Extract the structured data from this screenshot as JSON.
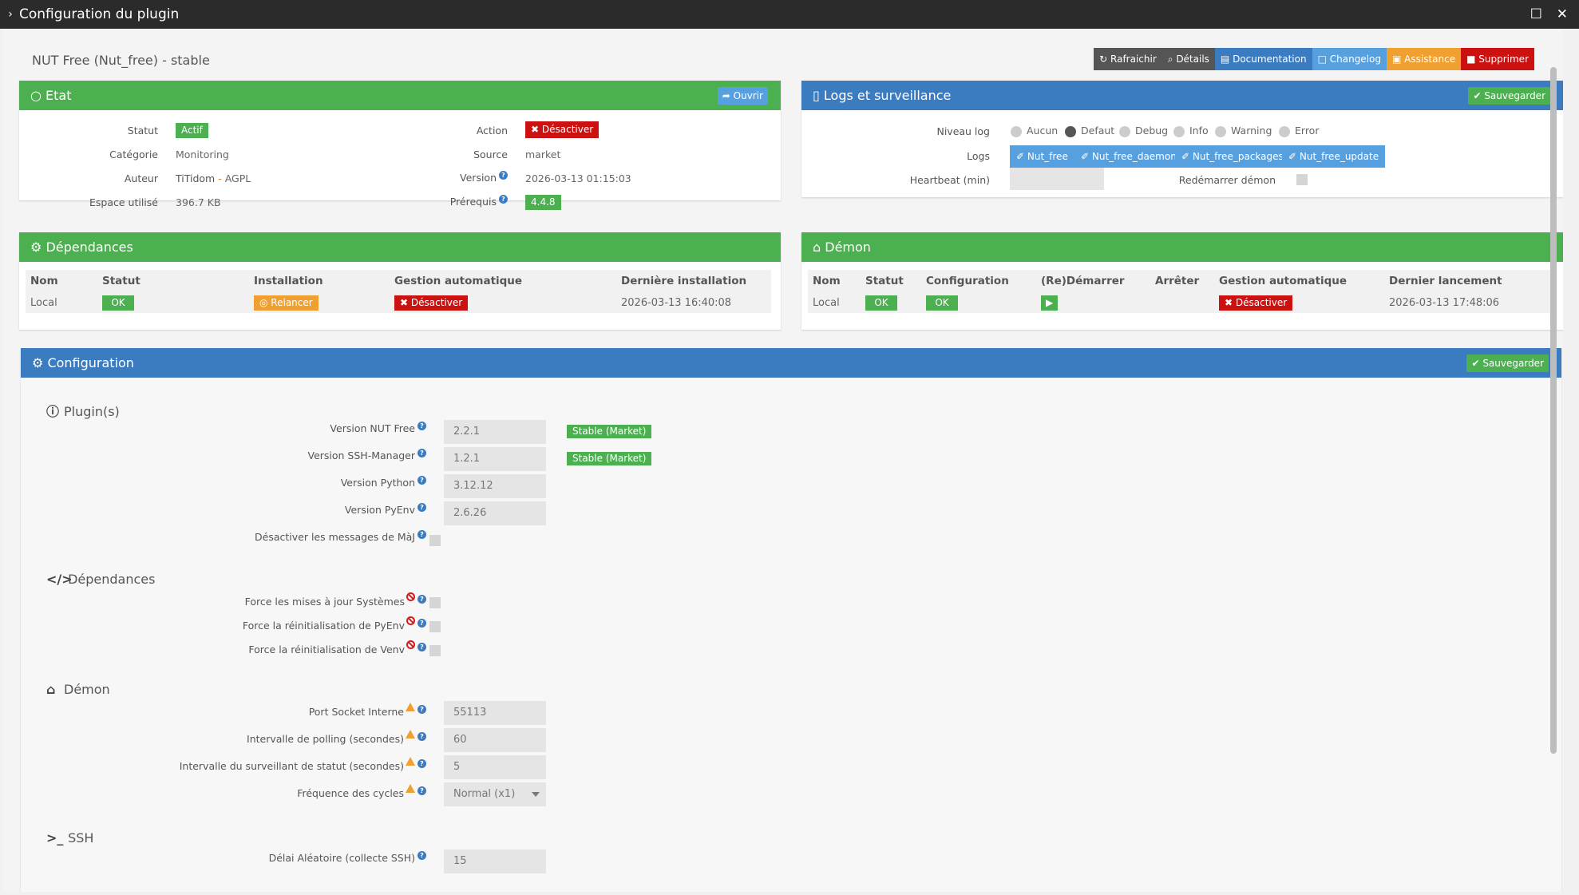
{
  "window": {
    "title": "Configuration du plugin"
  },
  "plugin": {
    "title": "NUT Free (Nut_free) - stable"
  },
  "actions": [
    {
      "label": "Rafraichir",
      "color": "#555555",
      "icon": "refresh-icon"
    },
    {
      "label": "Détails",
      "color": "#555555",
      "icon": "search-icon"
    },
    {
      "label": "Documentation",
      "color": "#3b7cc0",
      "icon": "book-icon"
    },
    {
      "label": "Changelog",
      "color": "#57a0e0",
      "icon": "file-icon"
    },
    {
      "label": "Assistance",
      "color": "#f0a030",
      "icon": "truck-icon"
    },
    {
      "label": "Supprimer",
      "color": "#cc1111",
      "icon": "trash-icon"
    }
  ],
  "etat": {
    "title": "Etat",
    "open_button": "Ouvrir",
    "statut_label": "Statut",
    "statut_value": "Actif",
    "categorie_label": "Catégorie",
    "categorie_value": "Monitoring",
    "auteur_label": "Auteur",
    "auteur_value": "TiTidom",
    "auteur_sep": " - ",
    "licence_value": "AGPL",
    "espace_label": "Espace utilisé",
    "espace_value": "396.7 KB",
    "action_label": "Action",
    "action_button": "Désactiver",
    "source_label": "Source",
    "source_value": "market",
    "version_label": "Version",
    "version_value": "2026-03-13 01:15:03",
    "prerequis_label": "Prérequis",
    "prerequis_value": "4.4.8"
  },
  "logs": {
    "title": "Logs et surveillance",
    "save_button": "Sauvegarder",
    "niveau_label": "Niveau log",
    "levels": [
      "Aucun",
      "Defaut",
      "Debug",
      "Info",
      "Warning",
      "Error"
    ],
    "selected_level": "Defaut",
    "logs_label": "Logs",
    "log_files": [
      "Nut_free",
      "Nut_free_daemon",
      "Nut_free_packages",
      "Nut_free_update"
    ],
    "heartbeat_label": "Heartbeat (min)",
    "heartbeat_value": "",
    "restart_label": "Redémarrer démon"
  },
  "dependances": {
    "title": "Dépendances",
    "headers": [
      "Nom",
      "Statut",
      "Installation",
      "Gestion automatique",
      "Dernière installation"
    ],
    "row": {
      "nom": "Local",
      "statut": "OK",
      "installation": "Relancer",
      "gestion": "Désactiver",
      "derniere": "2026-03-13 16:40:08"
    }
  },
  "demon": {
    "title": "Démon",
    "headers": [
      "Nom",
      "Statut",
      "Configuration",
      "(Re)Démarrer",
      "Arrêter",
      "Gestion automatique",
      "Dernier lancement"
    ],
    "row": {
      "nom": "Local",
      "statut": "OK",
      "configuration": "OK",
      "gestion": "Désactiver",
      "dernier": "2026-03-13 17:48:06"
    }
  },
  "configuration": {
    "title": "Configuration",
    "save_button": "Sauvegarder",
    "plugins_section": "Plugin(s)",
    "nut_version_label": "Version NUT Free",
    "nut_version_value": "2.2.1",
    "nut_stable": "Stable (Market)",
    "ssh_version_label": "Version SSH-Manager",
    "ssh_version_value": "1.2.1",
    "ssh_stable": "Stable (Market)",
    "python_label": "Version Python",
    "python_value": "3.12.12",
    "pyenv_label": "Version PyEnv",
    "pyenv_value": "2.6.26",
    "maj_label": "Désactiver les messages de MàJ",
    "dep_section": "Dépendances",
    "force_sys_label": "Force les mises à jour Systèmes",
    "force_pyenv_label": "Force la réinitialisation de PyEnv",
    "force_venv_label": "Force la réinitialisation de Venv",
    "demon_section": "Démon",
    "port_label": "Port Socket Interne",
    "port_value": "55113",
    "polling_label": "Intervalle de polling (secondes)",
    "polling_value": "60",
    "surv_label": "Intervalle du surveillant de statut (secondes)",
    "surv_value": "5",
    "freq_label": "Fréquence des cycles",
    "freq_value": "Normal (x1)",
    "ssh_section": "SSH",
    "delai_label": "Délai Aléatoire (collecte SSH)",
    "delai_value": "15"
  },
  "colors": {
    "green": "#4caf50",
    "blue": "#3b7cc0",
    "red": "#cc1111",
    "orange": "#f0a030",
    "lightblue": "#57a0e0"
  }
}
